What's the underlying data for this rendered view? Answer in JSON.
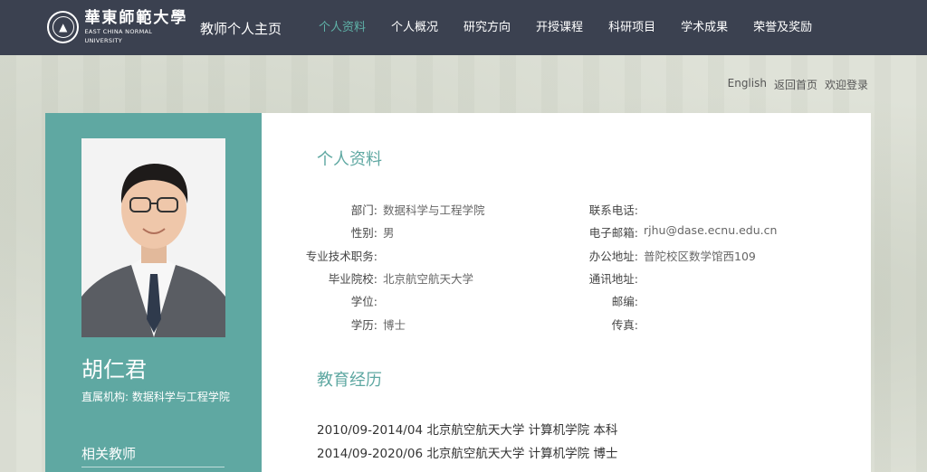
{
  "header": {
    "logo_cn": "華東師範大學",
    "logo_en": "EAST CHINA NORMAL UNIVERSITY",
    "site_title": "教师个人主页",
    "nav": [
      "个人资料",
      "个人概况",
      "研究方向",
      "开授课程",
      "科研项目",
      "学术成果",
      "荣誉及奖励"
    ]
  },
  "top_links": {
    "english": "English",
    "home": "返回首页",
    "login": "欢迎登录"
  },
  "sidebar": {
    "name": "胡仁君",
    "affiliation": "直属机构:  数据科学与工程学院",
    "related_title": "相关教师"
  },
  "profile": {
    "title": "个人资料",
    "left": [
      {
        "label": "部门:",
        "value": "数据科学与工程学院"
      },
      {
        "label": "性别:",
        "value": "男"
      },
      {
        "label": "专业技术职务:",
        "value": ""
      },
      {
        "label": "毕业院校:",
        "value": "北京航空航天大学"
      },
      {
        "label": "学位:",
        "value": ""
      },
      {
        "label": "学历:",
        "value": "博士"
      }
    ],
    "right": [
      {
        "label": "联系电话:",
        "value": ""
      },
      {
        "label": "电子邮箱:",
        "value": "rjhu@dase.ecnu.edu.cn"
      },
      {
        "label": "办公地址:",
        "value": "普陀校区数学馆西109"
      },
      {
        "label": "通讯地址:",
        "value": ""
      },
      {
        "label": "邮编:",
        "value": ""
      },
      {
        "label": "传真:",
        "value": ""
      }
    ]
  },
  "education": {
    "title": "教育经历",
    "items": [
      "2010/09-2014/04 北京航空航天大学 计算机学院 本科",
      "2014/09-2020/06 北京航空航天大学 计算机学院 博士"
    ]
  },
  "colors": {
    "navbar": "#3b4150",
    "accent": "#5fa8a2",
    "active_nav": "#5fb2a8"
  }
}
